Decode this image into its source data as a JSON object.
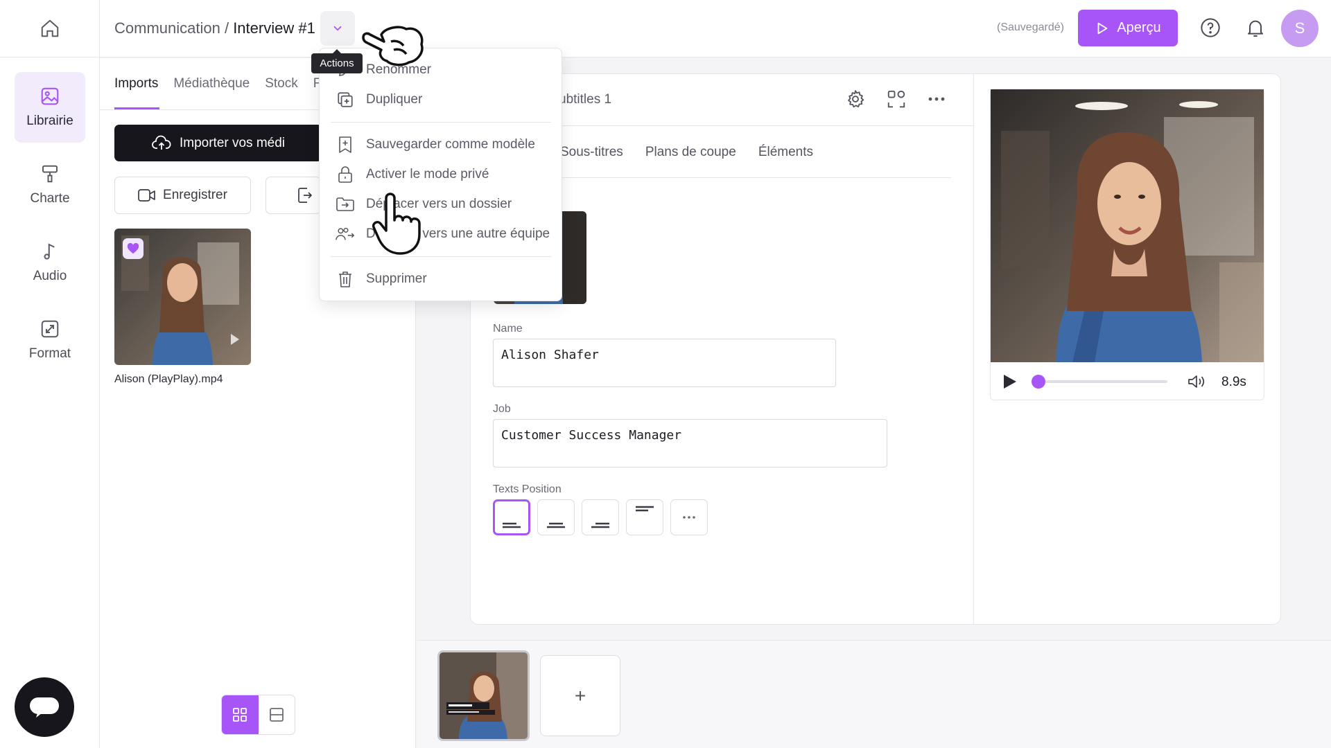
{
  "rail": {
    "items": [
      {
        "label": "Librairie",
        "icon": "image-icon",
        "active": true
      },
      {
        "label": "Charte",
        "icon": "paint-roller-icon"
      },
      {
        "label": "Audio",
        "icon": "music-note-icon"
      },
      {
        "label": "Format",
        "icon": "resize-icon"
      }
    ]
  },
  "header": {
    "breadcrumb_parent": "Communication",
    "breadcrumb_sep": " / ",
    "breadcrumb_current": "Interview #1",
    "tooltip": "Actions",
    "saved_status": "(Sauvegardé)",
    "preview_button": "Aperçu",
    "avatar_initial": "S"
  },
  "library": {
    "tabs": [
      "Imports",
      "Médiathèque",
      "Stock",
      "F"
    ],
    "import_button": "Importer vos médi",
    "record_button": "Enregistrer",
    "media": [
      {
        "name": "Alison (PlayPlay).mp4"
      }
    ]
  },
  "menu": {
    "items": [
      {
        "label": "Renommer",
        "icon": "pencil-icon"
      },
      {
        "label": "Dupliquer",
        "icon": "duplicate-icon"
      },
      {
        "label": "Sauvegarder comme modèle",
        "icon": "bookmark-add-icon"
      },
      {
        "label": "Activer le mode privé",
        "icon": "lock-icon"
      },
      {
        "label": "Déplacer vers un dossier",
        "icon": "move-to-folder-icon"
      },
      {
        "label": "Déplacer vers une autre équipe",
        "icon": "move-to-team-icon"
      },
      {
        "label": "Supprimer",
        "icon": "trash-icon"
      }
    ]
  },
  "editor": {
    "scene_name": "ubtitles 1",
    "subtabs": [
      "Sous-titres",
      "Plans de coupe",
      "Éléments"
    ],
    "name_label": "Name",
    "name_value": "Alison Shafer",
    "job_label": "Job",
    "job_value": "Customer Success Manager",
    "position_label": "Texts Position",
    "positions": [
      "bottom-left",
      "bottom-center",
      "bottom-right",
      "top-left",
      "more"
    ],
    "selected_position": "bottom-left"
  },
  "preview": {
    "duration": "8.9s",
    "progress": 0.05
  },
  "timeline": {
    "add_label": "+"
  },
  "colors": {
    "accent": "#a855f7",
    "dark": "#16161c"
  }
}
